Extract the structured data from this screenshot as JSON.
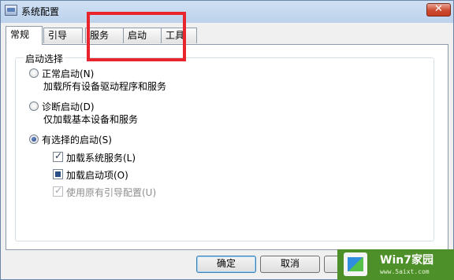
{
  "window": {
    "title": "系统配置",
    "close_glyph": "✕"
  },
  "tabs": [
    {
      "label": "常规",
      "active": true
    },
    {
      "label": "引导",
      "active": false
    },
    {
      "label": "服务",
      "active": false
    },
    {
      "label": "启动",
      "active": false
    },
    {
      "label": "工具",
      "active": false
    }
  ],
  "startup": {
    "group_label": "启动选择",
    "options": [
      {
        "label": "正常启动(N)",
        "desc": "加载所有设备驱动程序和服务",
        "selected": false
      },
      {
        "label": "诊断启动(D)",
        "desc": "仅加载基本设备和服务",
        "selected": false
      },
      {
        "label": "有选择的启动(S)",
        "desc": "",
        "selected": true
      }
    ],
    "selective": [
      {
        "label": "加载系统服务(L)",
        "state": "checked",
        "enabled": true
      },
      {
        "label": "加载启动项(O)",
        "state": "indeterminate",
        "enabled": true
      },
      {
        "label": "使用原有引导配置(U)",
        "state": "checked",
        "enabled": false
      }
    ]
  },
  "buttons": {
    "ok": "确定",
    "cancel": "取消",
    "apply": ""
  },
  "watermark": {
    "title": "Win7家园",
    "url": "www.5aixt.com"
  },
  "colors": {
    "highlight": "#e8242d",
    "watermark_bg": "#4d8f28",
    "close_button": "#cc4b30"
  }
}
